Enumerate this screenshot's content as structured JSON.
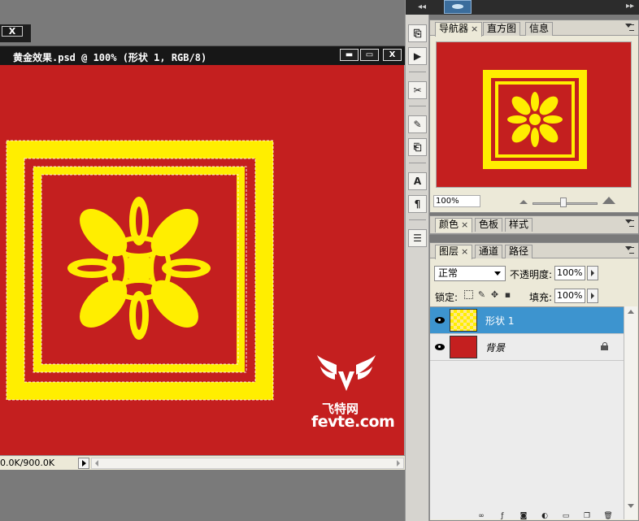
{
  "document": {
    "title": "黄金效果.psd @ 100% (形状 1, RGB/8)",
    "status": "0.0K/900.0K",
    "minimize": "▬",
    "maximize": "▭",
    "close": "X",
    "ghost_close": "X"
  },
  "watermark": {
    "line1": "飞特网",
    "line2": "fevte.com"
  },
  "colors": {
    "canvas_red": "#c41f1f",
    "gold_yellow": "#ffee00",
    "selection": "#3d94cf"
  },
  "toolstrip": {
    "icons": [
      "history-icon",
      "actions-icon",
      "tool-presets-icon",
      "brush-icon",
      "clone-source-icon",
      "character-icon",
      "paragraph-icon",
      "layer-comps-icon"
    ]
  },
  "navigator_panel": {
    "tabs": [
      {
        "label": "导航器",
        "close": "×"
      },
      {
        "label": "直方图"
      },
      {
        "label": "信息"
      }
    ],
    "zoom": "100%"
  },
  "color_panel": {
    "tabs": [
      {
        "label": "颜色",
        "close": "×"
      },
      {
        "label": "色板"
      },
      {
        "label": "样式"
      }
    ]
  },
  "layers_panel": {
    "tabs": [
      {
        "label": "图层",
        "close": "×"
      },
      {
        "label": "通道"
      },
      {
        "label": "路径"
      }
    ],
    "blend_mode": "正常",
    "opacity_label": "不透明度:",
    "opacity": "100%",
    "lock_label": "锁定:",
    "fill_label": "填充:",
    "fill": "100%",
    "layers": [
      {
        "name": "形状 1",
        "selected": true
      },
      {
        "name": "背景",
        "selected": false,
        "locked": true
      }
    ]
  }
}
